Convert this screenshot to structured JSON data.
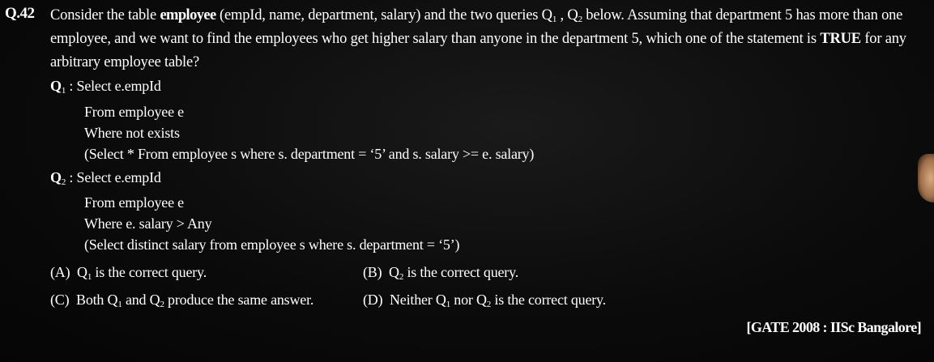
{
  "question": {
    "number": "Q.42",
    "stem_before": "Consider the table ",
    "table_name": "employee",
    "stem_mid": " (empId, name, department, salary) and the two queries Q",
    "q1_sub": "1",
    "stem_comma": " , Q",
    "q2_sub": "2",
    "stem_after": " below. Assuming that department 5 has more than one employee, and we want to find the employees who get higher salary than anyone in the department 5, which one of the statement is ",
    "true_word": "TRUE",
    "stem_end": " for any arbitrary employee table?"
  },
  "queries": {
    "q1": {
      "label": "Q",
      "sub": "1",
      "colon": " : ",
      "line1": "Select e.empId",
      "line2": "From employee e",
      "line3": "Where not exists",
      "line4": "(Select * From employee s where s. department = ‘5’ and s. salary >= e. salary)"
    },
    "q2": {
      "label": "Q",
      "sub": "2",
      "colon": " : ",
      "line1": "Select e.empId",
      "line2": "From employee e",
      "line3": "Where e. salary > Any",
      "line4": "(Select distinct salary from employee s where s. department = ‘5’)"
    }
  },
  "options": {
    "a": {
      "label": "(A)",
      "pre": "Q",
      "sub1": "1",
      "post": " is the correct query."
    },
    "b": {
      "label": "(B)",
      "pre": "Q",
      "sub1": "2",
      "post": " is the correct query."
    },
    "c": {
      "label": "(C)",
      "pre": "Both Q",
      "sub1": "1",
      "mid": " and Q",
      "sub2": "2",
      "post": " produce the same answer."
    },
    "d": {
      "label": "(D)",
      "pre": "Neither Q",
      "sub1": "1",
      "mid": " nor Q",
      "sub2": "2",
      "post": " is the correct query."
    }
  },
  "reference": "[GATE 2008 : IISc Bangalore]"
}
